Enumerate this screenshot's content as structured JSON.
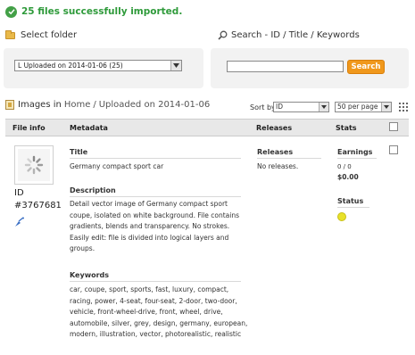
{
  "banner": {
    "message": "25 files successfully imported.",
    "status_color": "#2e9a3a",
    "icon": "check-circle-icon"
  },
  "folder": {
    "title": "Select folder",
    "selected": "L Uploaded on 2014-01-06 (25)"
  },
  "search": {
    "title": "Search - ID / Title / Keywords",
    "value": "",
    "button_label": "Search",
    "button_color": "#f0981c"
  },
  "images": {
    "prefix": "Images in",
    "crumb_home": "Home",
    "separator": "/",
    "crumb_current": "Uploaded on 2014-01-06"
  },
  "sort": {
    "label": "Sort by",
    "selected": "ID",
    "per_page": "50 per page"
  },
  "table": {
    "headers": {
      "file_info": "File info",
      "metadata": "Metadata",
      "releases": "Releases",
      "stats": "Stats"
    }
  },
  "row": {
    "id_label": "ID",
    "id_value": "#3767681",
    "title_label": "Title",
    "title_value": "Germany compact sport car",
    "description_label": "Description",
    "description_lines": [
      "Detail vector image of Germany compact sport",
      "coupe, isolated on white background. File contains",
      "gradients, blends and transparency. No strokes.",
      "Easily edit: file is divided into logical layers and",
      "groups."
    ],
    "keywords_label": "Keywords",
    "keywords_lines": [
      "car, coupe, sport, sports, fast, luxury, compact,",
      "racing, power, 4-seat, four-seat, 2-door, two-door,",
      "vehicle, front-wheel-drive, front, wheel, drive,",
      "automobile, silver, grey, design, germany, european,",
      "modern, illustration, vector, photorealistic, realistic"
    ],
    "releases_label": "Releases",
    "releases_value": "No releases.",
    "earnings_label": "Earnings",
    "earnings_count": "0 / 0",
    "earnings_amount": "$0.00",
    "status_label": "Status",
    "status_color": "#e8e12a"
  }
}
